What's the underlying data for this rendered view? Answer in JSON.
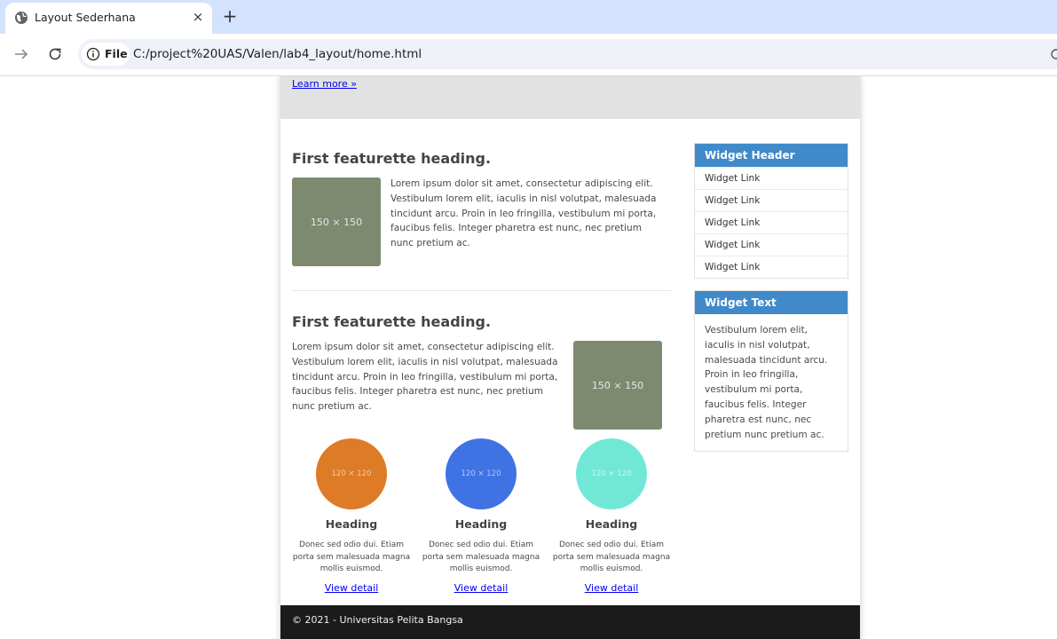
{
  "browser": {
    "tab_title": "Layout Sederhana",
    "tab_close": "×",
    "new_tab": "+",
    "site_chip_label": "File",
    "url": "C:/project%20UAS/Valen/lab4_layout/home.html"
  },
  "jumbotron": {
    "learn_more": "Learn more »"
  },
  "featurettes": [
    {
      "heading": "First featurette heading.",
      "image_label": "150 × 150",
      "image_color": "#7e8a70",
      "text": "Lorem ipsum dolor sit amet, consectetur adipiscing elit. Vestibulum lorem elit, iaculis in nisl volutpat, malesuada tincidunt arcu. Proin in leo fringilla, vestibulum mi porta, faucibus felis. Integer pharetra est nunc, nec pretium nunc pretium ac."
    },
    {
      "heading": "First featurette heading.",
      "image_label": "150 × 150",
      "image_color": "#7e8a70",
      "text": "Lorem ipsum dolor sit amet, consectetur adipiscing elit. Vestibulum lorem elit, iaculis in nisl volutpat, malesuada tincidunt arcu. Proin in leo fringilla, vestibulum mi porta, faucibus felis. Integer pharetra est nunc, nec pretium nunc pretium ac."
    }
  ],
  "columns": [
    {
      "image_label": "120 × 120",
      "color": "#dd7b26",
      "heading": "Heading",
      "text": "Donec sed odio dui. Etiam porta sem malesuada magna mollis euismod.",
      "link": "View detail"
    },
    {
      "image_label": "120 × 120",
      "color": "#3f73e4",
      "heading": "Heading",
      "text": "Donec sed odio dui. Etiam porta sem malesuada magna mollis euismod.",
      "link": "View detail"
    },
    {
      "image_label": "120 × 120",
      "color": "#71e8d6",
      "heading": "Heading",
      "text": "Donec sed odio dui. Etiam porta sem malesuada magna mollis euismod.",
      "link": "View detail"
    }
  ],
  "sidebar": {
    "links_widget": {
      "header": "Widget Header",
      "links": [
        "Widget Link",
        "Widget Link",
        "Widget Link",
        "Widget Link",
        "Widget Link"
      ]
    },
    "text_widget": {
      "header": "Widget Text",
      "text": "Vestibulum lorem elit, iaculis in nisl volutpat, malesuada tincidunt arcu. Proin in leo fringilla, vestibulum mi porta, faucibus felis. Integer pharetra est nunc, nec pretium nunc pretium ac."
    },
    "header_color": "#418ac9"
  },
  "footer": {
    "text": "© 2021 - Universitas Pelita Bangsa"
  }
}
